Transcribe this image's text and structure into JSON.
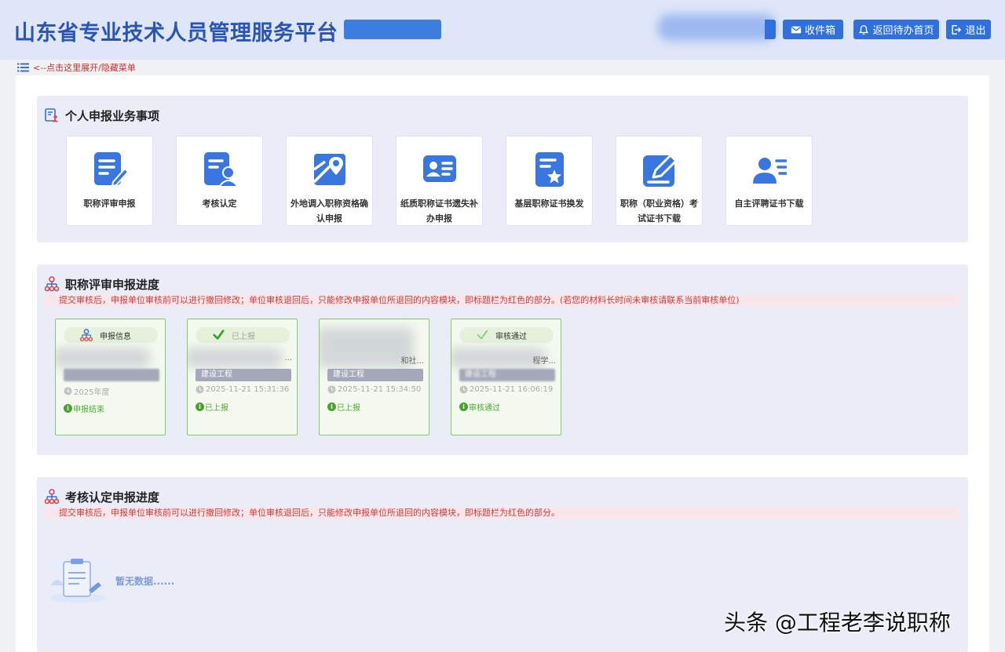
{
  "header": {
    "site_title": "山东省专业技术人员管理服务平台",
    "separator": "|",
    "role_text": "         ",
    "buttons": [
      {
        "label": "收件箱",
        "icon": "mail-icon"
      },
      {
        "label": "返回待办首页",
        "icon": "bell-icon"
      },
      {
        "label": "退出",
        "icon": "logout-icon"
      }
    ]
  },
  "menu_toggle": {
    "label": "<--点击这里展开/隐藏菜单",
    "icon": "list-icon"
  },
  "business": {
    "title": "个人申报业务事项",
    "items": [
      {
        "label": "职称评审申报",
        "icon": "doc-edit-icon"
      },
      {
        "label": "考核认定",
        "icon": "doc-user-icon"
      },
      {
        "label": "外地调入职称资格确认申报",
        "icon": "map-pin-icon"
      },
      {
        "label": "纸质职称证书遗失补办申报",
        "icon": "id-card-icon"
      },
      {
        "label": "基层职称证书换发",
        "icon": "doc-star-icon"
      },
      {
        "label": "职称（职业资格）考试证书下载",
        "icon": "pen-square-icon"
      },
      {
        "label": "自主评聘证书下载",
        "icon": "user-list-icon"
      }
    ]
  },
  "progress": {
    "title": "职称评审申报进度",
    "notice": "提交审核后，申报单位审核前可以进行撤回修改；单位审核退回后，只能修改申报单位所退回的内容模块，即标题栏为红色的部分。(若您的材料长时间未审核请联系当前审核单位)",
    "cards": [
      {
        "pill": "申报信息",
        "pill_icon": "org-chart-icon",
        "fragment": "",
        "category": "",
        "date": "2025年度",
        "status": "申报结束"
      },
      {
        "pill": "已上报",
        "pill_icon": "check-icon",
        "fragment": "...",
        "category": "建设工程",
        "date": "2025-11-21 15:31:36",
        "status": "已上报"
      },
      {
        "pill": "",
        "pill_icon": "",
        "fragment": "和社...",
        "category": "建设工程",
        "date": "2025-11-21 15:34:50",
        "status": "已上报"
      },
      {
        "pill": "审核通过",
        "pill_icon": "check-icon",
        "fragment": "程学...",
        "category": "建设工程",
        "date": "2025-11-21 16:06:19",
        "status": "审核通过"
      }
    ]
  },
  "assessment": {
    "title": "考核认定申报进度",
    "notice": "提交审核后，申报单位审核前可以进行撤回修改；单位审核退回后，只能修改申报单位所退回的内容模块，即标题栏为红色的部分。",
    "empty_text": "暂无数据......"
  },
  "watermark": "头条 @工程老李说职称",
  "colors": {
    "brand_blue": "#2f6fde",
    "title_blue": "#2a55b8",
    "panel_bg": "#eaedf8",
    "card_border": "#7fce63",
    "notice_red": "#d43a3a",
    "status_green": "#4caa2e"
  }
}
